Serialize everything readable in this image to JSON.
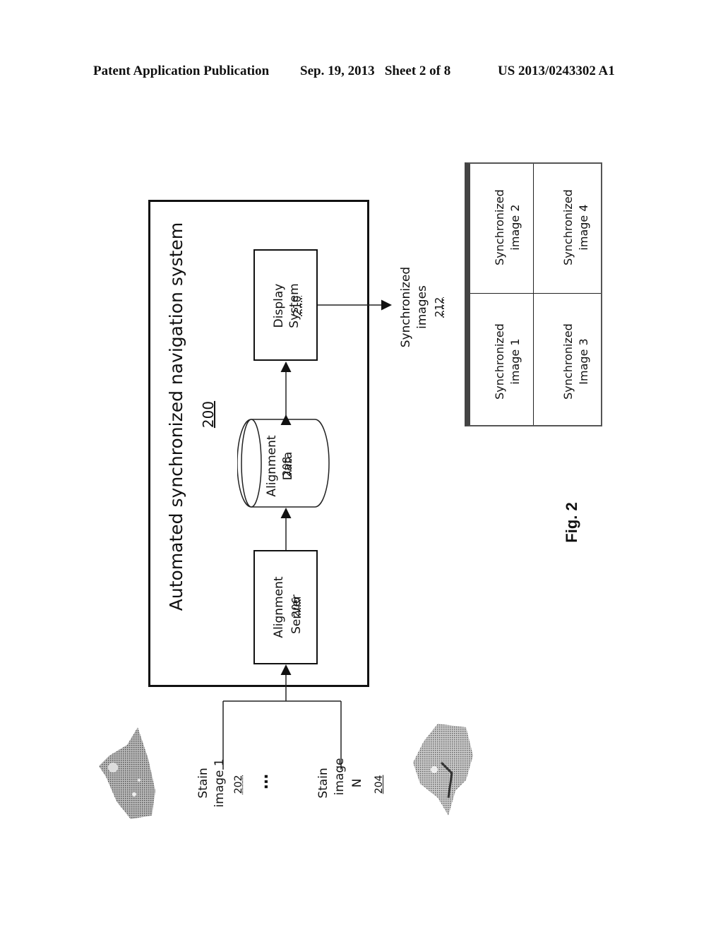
{
  "header": {
    "publication": "Patent Application Publication",
    "date_sheet": "Sep. 19, 2013   Sheet 2 of 8",
    "number": "US 2013/0243302 A1"
  },
  "diagram": {
    "system_title": "Automated synchronized navigation system",
    "system_ref": "200",
    "alignment_server": {
      "line1": "Alignment",
      "line2": "Server",
      "ref": "206"
    },
    "alignment_data": {
      "line1": "Alignment",
      "line2": "Data",
      "ref": "208"
    },
    "display_system": {
      "line1": "Display",
      "line2": "System",
      "ref": "210"
    },
    "stain_image_1": {
      "line1": "Stain",
      "line2": "image 1",
      "ref": "202"
    },
    "ellipsis": "…",
    "stain_image_n": {
      "line1": "Stain",
      "line2": "image",
      "line3": "N",
      "ref": "204"
    },
    "synchronized_images": {
      "line1": "Synchronized",
      "line2": "images",
      "ref": "212"
    },
    "grid": [
      {
        "line1": "Synchronized",
        "line2": "image 1"
      },
      {
        "line1": "Synchronized",
        "line2": "image 2"
      },
      {
        "line1": "Synchronized",
        "line2": "Image 3"
      },
      {
        "line1": "Synchronized",
        "line2": "image 4"
      }
    ]
  },
  "figure_label": "Fig. 2"
}
